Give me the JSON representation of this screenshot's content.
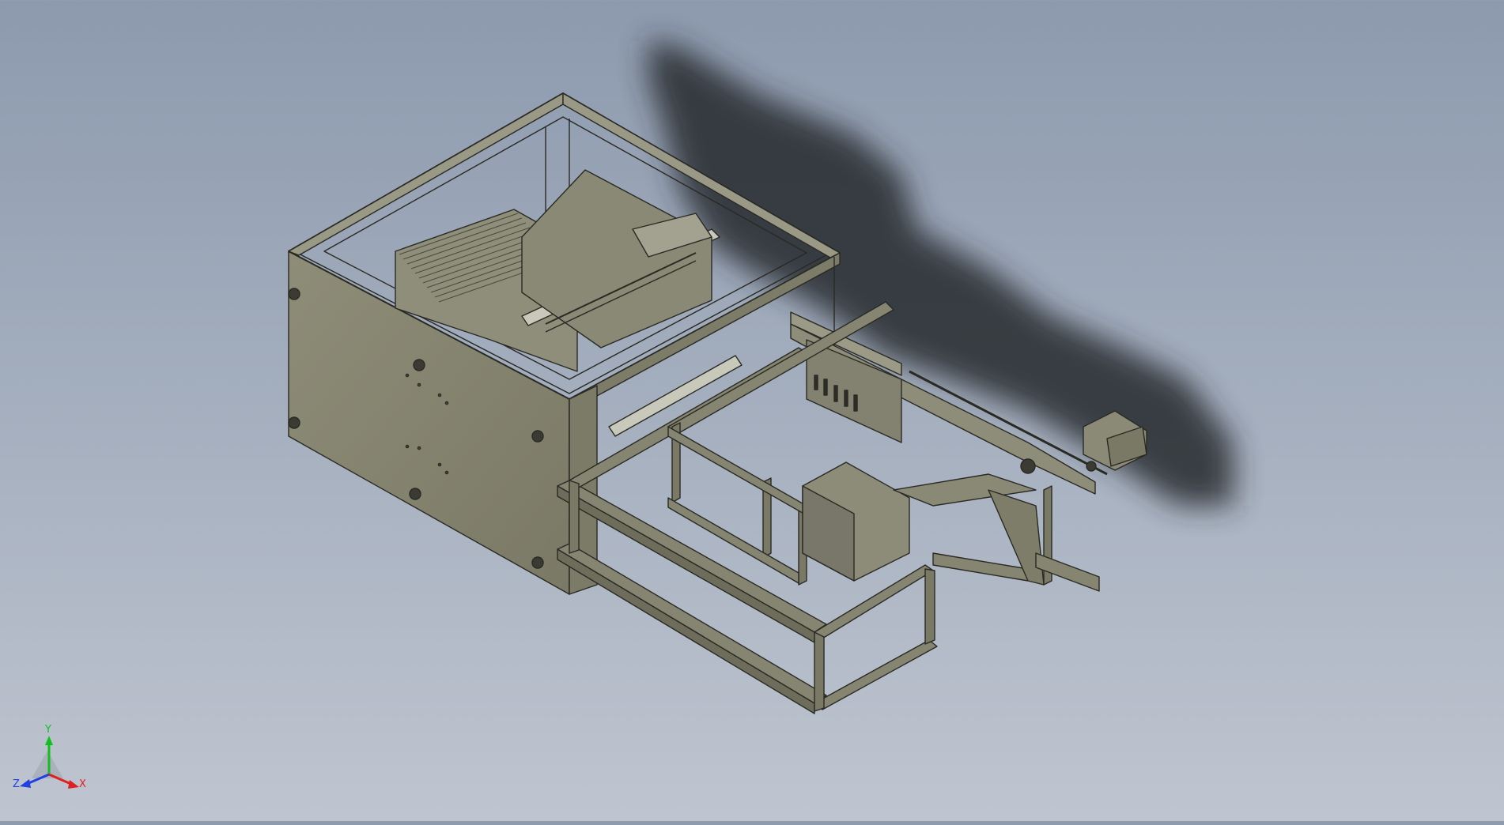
{
  "view": {
    "background_top": "#8d9aae",
    "background_bottom": "#bfc5d0",
    "model_color": "#858571",
    "edge_color": "#2a2a24"
  },
  "triad": {
    "x_label": "X",
    "y_label": "Y",
    "z_label": "Z",
    "x_color": "#e02020",
    "y_color": "#10c020",
    "z_color": "#2040e0"
  }
}
